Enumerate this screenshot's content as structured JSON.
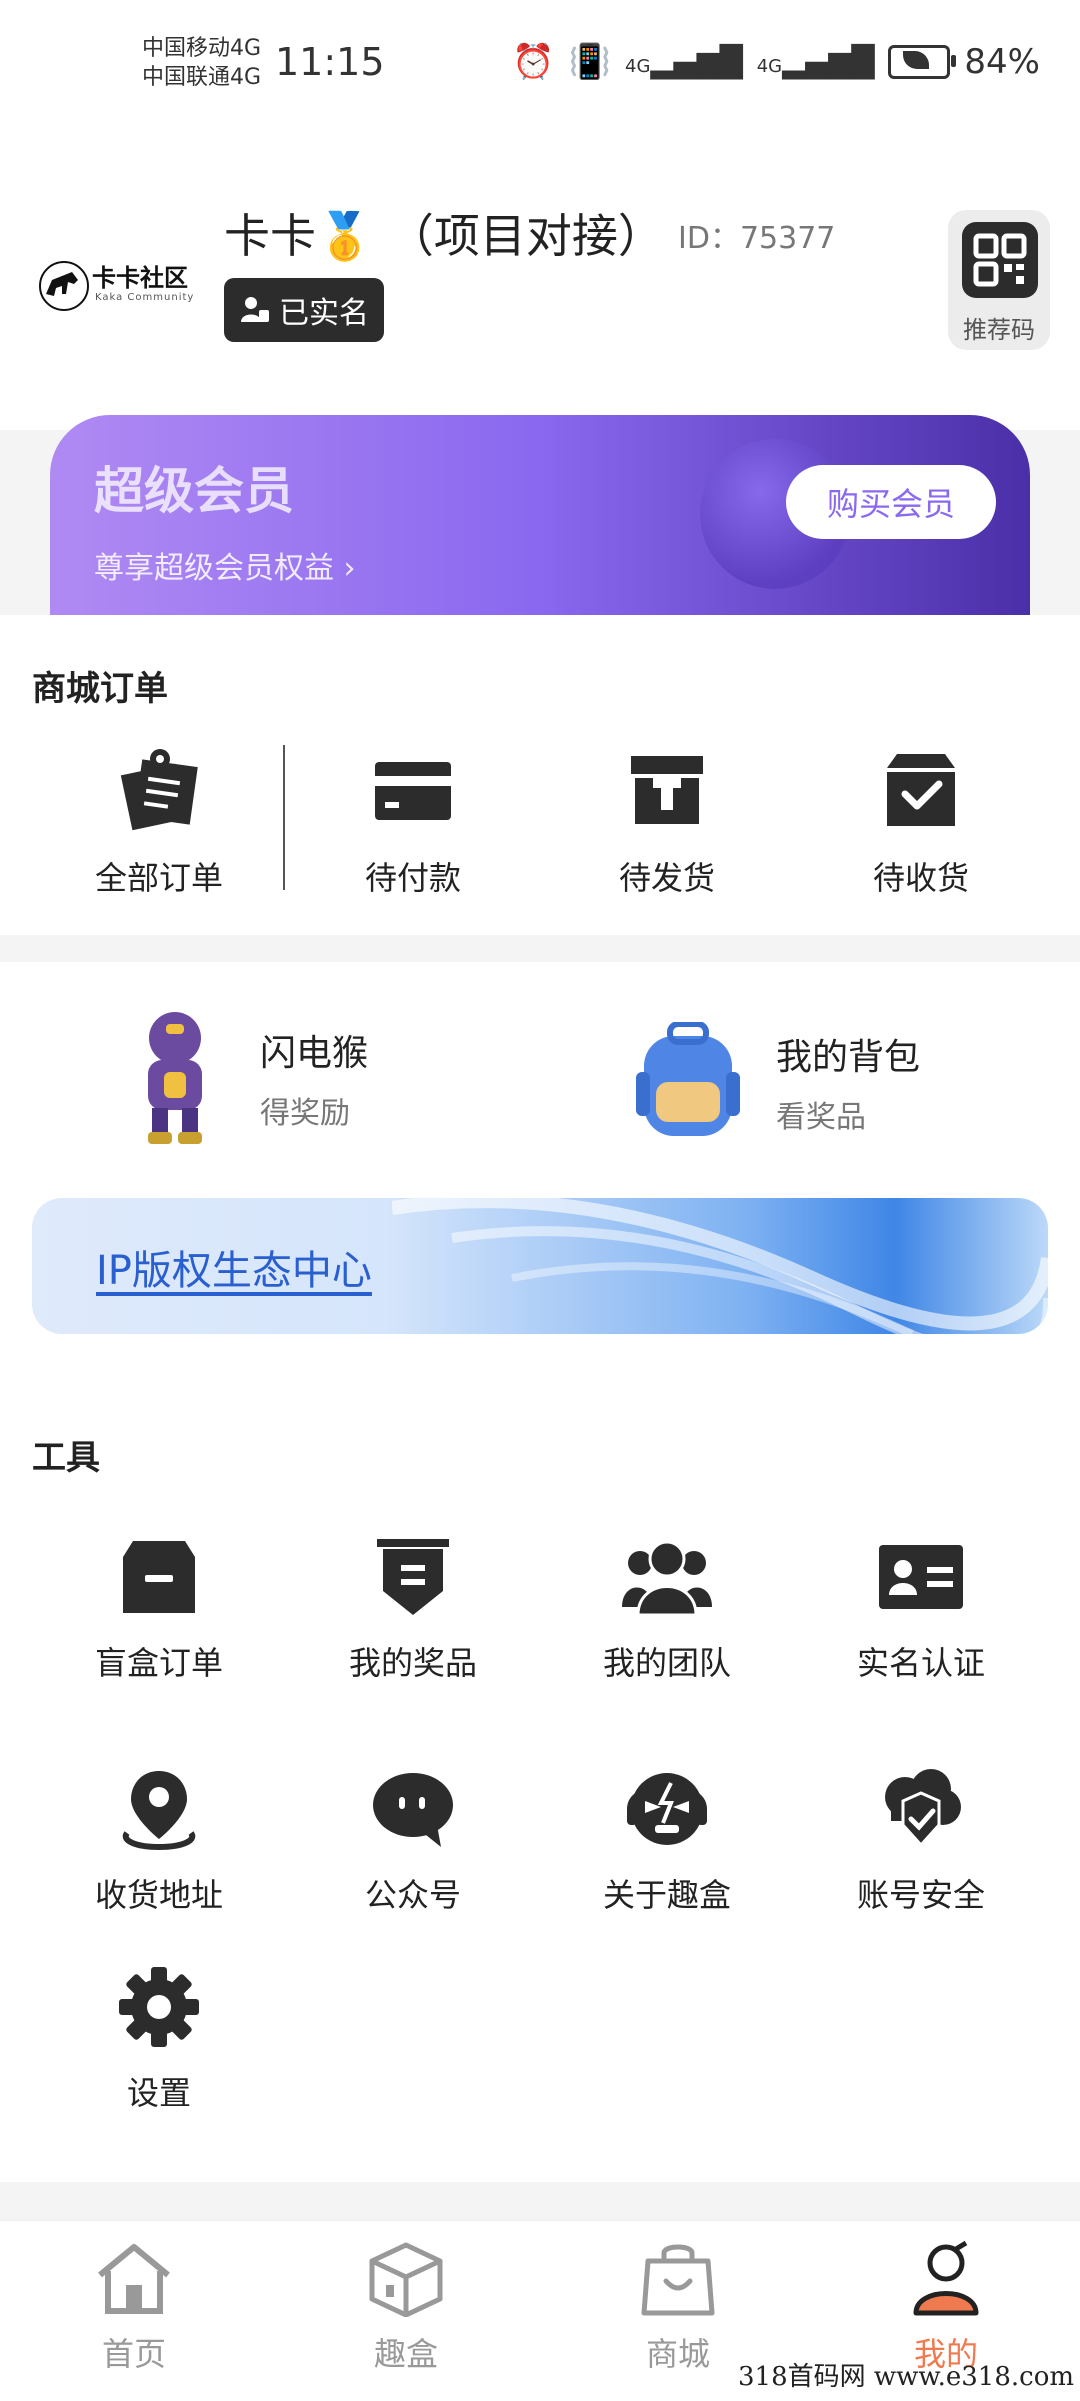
{
  "status_bar": {
    "carrier1": "中国移动4G",
    "carrier2": "中国联通4G",
    "time": "11:15",
    "signal1": "4G",
    "signal2": "4G",
    "battery": "84%"
  },
  "profile": {
    "logo_text": "卡卡社区",
    "logo_sub": "Kaka Community",
    "nickname": "卡卡🥇 （项目对接）",
    "id_text": "ID：75377",
    "verified_badge": "已实名",
    "qr_label": "推荐码"
  },
  "vip": {
    "title": "超级会员",
    "subtitle": "尊享超级会员权益 ›",
    "button": "购买会员"
  },
  "orders": {
    "title": "商城订单",
    "items": [
      {
        "label": "全部订单",
        "icon": "all-orders-icon"
      },
      {
        "label": "待付款",
        "icon": "card-icon"
      },
      {
        "label": "待发货",
        "icon": "box-icon"
      },
      {
        "label": "待收货",
        "icon": "check-box-icon"
      }
    ]
  },
  "features": [
    {
      "title": "闪电猴",
      "subtitle": "得奖励"
    },
    {
      "title": "我的背包",
      "subtitle": "看奖品"
    }
  ],
  "ip_banner": {
    "text": "IP版权生态中心"
  },
  "tools": {
    "title": "工具",
    "items": [
      {
        "label": "盲盒订单",
        "icon": "blind-box-icon"
      },
      {
        "label": "我的奖品",
        "icon": "prize-icon"
      },
      {
        "label": "我的团队",
        "icon": "team-icon"
      },
      {
        "label": "实名认证",
        "icon": "id-card-icon"
      },
      {
        "label": "收货地址",
        "icon": "location-icon"
      },
      {
        "label": "公众号",
        "icon": "chat-icon"
      },
      {
        "label": "关于趣盒",
        "icon": "about-icon"
      },
      {
        "label": "账号安全",
        "icon": "security-icon"
      },
      {
        "label": "设置",
        "icon": "gear-icon"
      }
    ]
  },
  "nav": [
    {
      "label": "首页",
      "icon": "home-icon"
    },
    {
      "label": "趣盒",
      "icon": "cube-icon"
    },
    {
      "label": "商城",
      "icon": "bag-icon"
    },
    {
      "label": "我的",
      "icon": "user-icon"
    }
  ],
  "watermark": "318首码网  www.e318.com",
  "colors": {
    "accent": "#f07a4f",
    "vip_start": "#b08af3",
    "vip_end": "#4a2fa8",
    "icon": "#2c2c2c"
  }
}
